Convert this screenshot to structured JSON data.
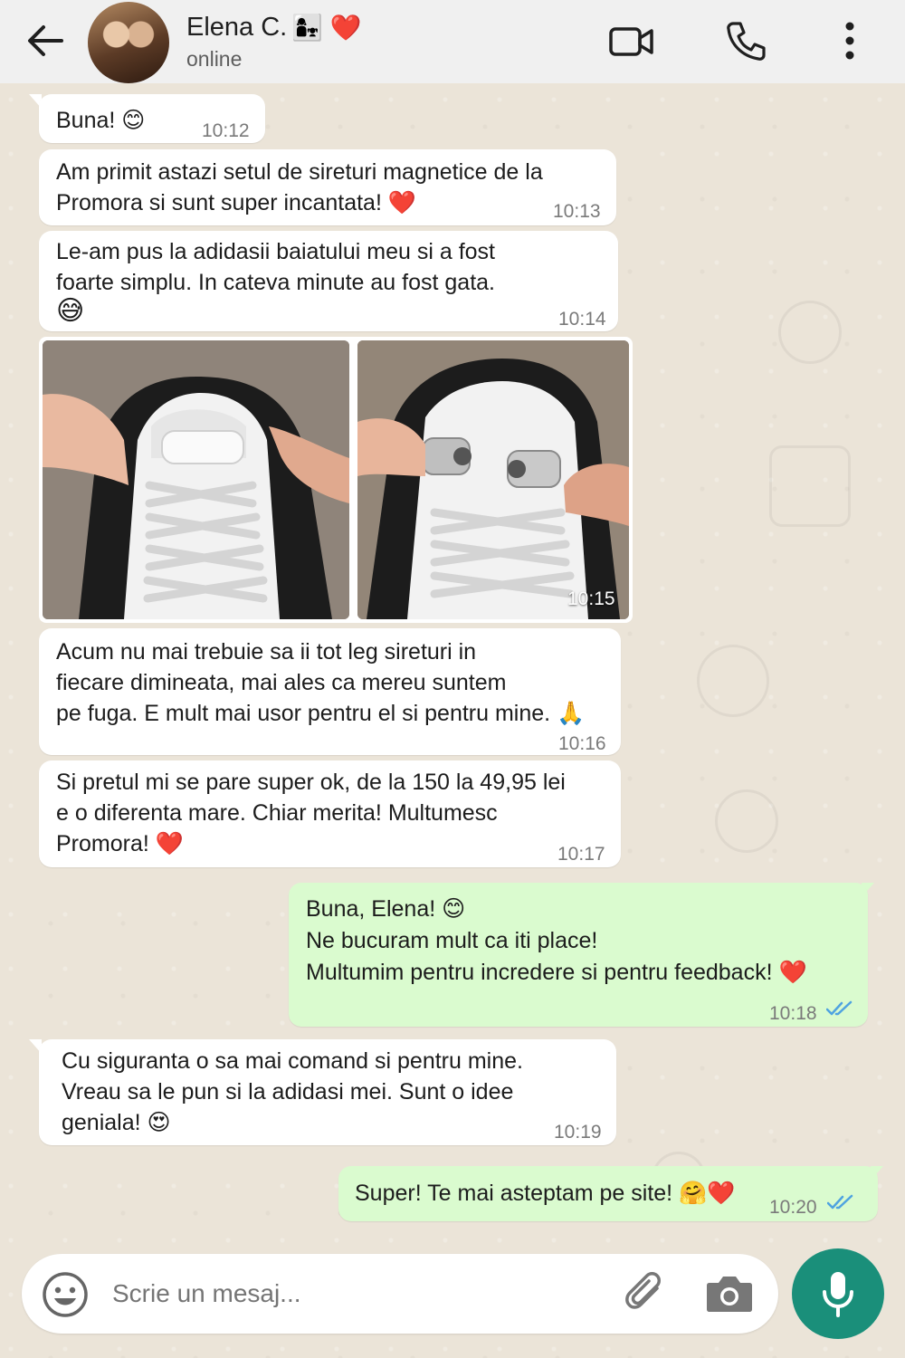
{
  "header": {
    "contact_name": "Elena C.",
    "contact_emoji": "👩‍👧",
    "contact_heart": "❤️",
    "status": "online",
    "icons": [
      "back-arrow-icon",
      "video-call-icon",
      "phone-icon",
      "more-options-icon"
    ]
  },
  "messages": [
    {
      "dir": "in",
      "lines": [
        "Buna! 😊"
      ],
      "time": "10:12"
    },
    {
      "dir": "in",
      "lines": [
        "Am primit astazi setul de sireturi magnetice de la",
        "Promora si sunt super incantata! ❤️"
      ],
      "time": "10:13"
    },
    {
      "dir": "in",
      "lines": [
        "Le-am pus la adidasii baiatului meu si a fost",
        "foarte simplu. In cateva minute au fost gata.",
        "😅"
      ],
      "time": "10:14"
    },
    {
      "dir": "in",
      "type": "images",
      "images": [
        "shoe-magnetic-lace-closed-photo",
        "shoe-magnetic-lace-open-photo"
      ],
      "time": "10:15"
    },
    {
      "dir": "in",
      "lines": [
        "Acum nu mai trebuie sa ii tot leg sireturi in",
        "fiecare dimineata, mai ales ca mereu suntem",
        "pe fuga. E mult mai usor pentru el si pentru mine. 🙏"
      ],
      "time": "10:16"
    },
    {
      "dir": "in",
      "lines": [
        "Si pretul mi se pare super ok, de la 150 la 49,95 lei",
        "e o diferenta mare. Chiar merita! Multumesc",
        "Promora! ❤️"
      ],
      "time": "10:17"
    },
    {
      "dir": "out",
      "lines": [
        "Buna, Elena! 😊",
        "Ne bucuram mult ca iti place!",
        "Multumim pentru incredere si pentru feedback! ❤️"
      ],
      "time": "10:18",
      "status": "read"
    },
    {
      "dir": "in",
      "lines": [
        "Cu siguranta o sa mai comand si pentru mine.",
        "Vreau sa le pun si la adidasi mei. Sunt o idee",
        "geniala! 😍"
      ],
      "time": "10:19"
    },
    {
      "dir": "out",
      "lines": [
        "Super! Te mai asteptam pe site! 🤗❤️"
      ],
      "time": "10:20",
      "status": "read"
    }
  ],
  "composer": {
    "placeholder": "Scrie un mesaj...",
    "icons": [
      "emoji-icon",
      "attach-icon",
      "camera-icon",
      "microphone-icon"
    ]
  },
  "colors": {
    "incoming_bubble": "#ffffff",
    "outgoing_bubble": "#dafbcf",
    "accent": "#1a8f7a",
    "read_ticks": "#4fa3e0",
    "wallpaper": "#ebe4d8"
  }
}
